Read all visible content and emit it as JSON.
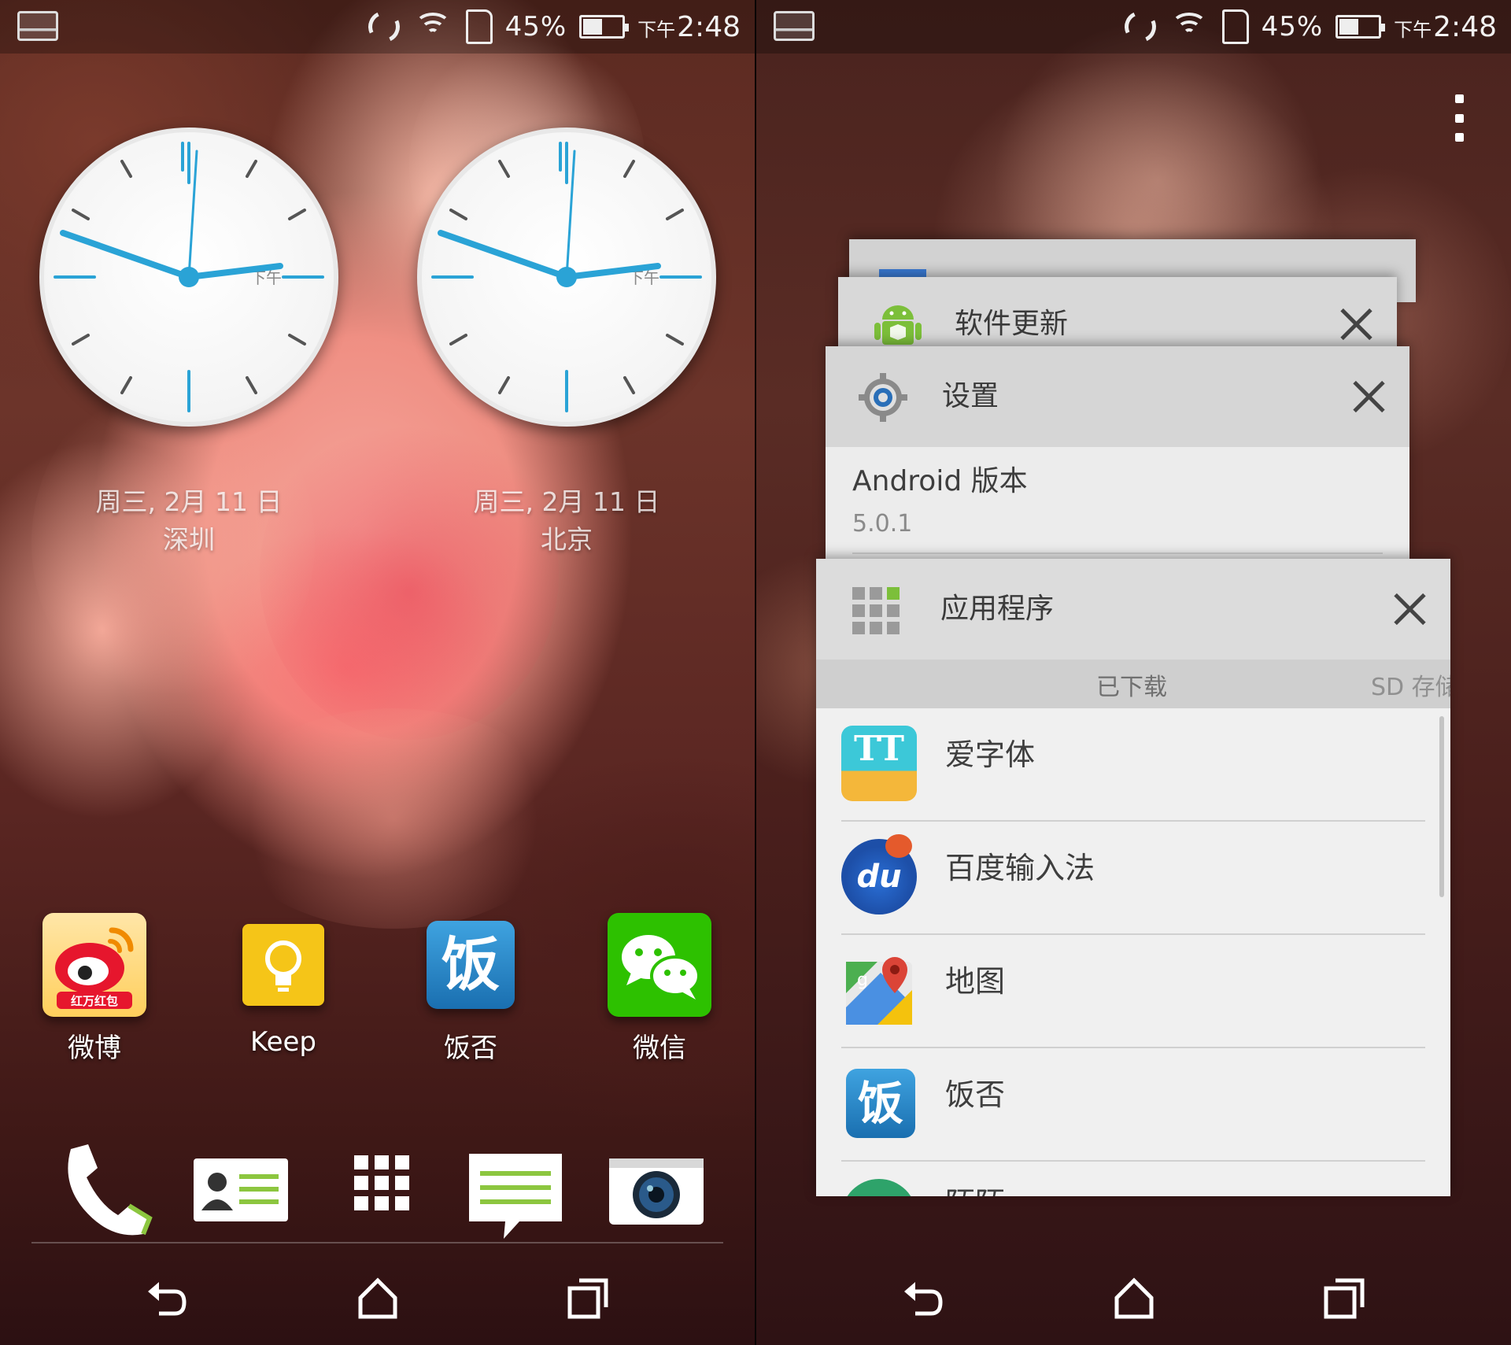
{
  "status_bar": {
    "battery_pct": "45%",
    "time_prefix": "下午",
    "time": "2:48"
  },
  "home": {
    "clocks": [
      {
        "date": "周三, 2月 11 日",
        "city": "深圳",
        "ampm": "下午"
      },
      {
        "date": "周三, 2月 11 日",
        "city": "北京",
        "ampm": "下午"
      }
    ],
    "apps": [
      {
        "label": "微博",
        "icon": "weibo-icon",
        "badge_text": "红万红包"
      },
      {
        "label": "Keep",
        "icon": "keep-lightbulb-icon"
      },
      {
        "label": "饭否",
        "icon": "fanfou-icon",
        "glyph": "饭"
      },
      {
        "label": "微信",
        "icon": "wechat-icon"
      }
    ],
    "dock": [
      "phone-icon",
      "contacts-icon",
      "app-drawer-icon",
      "messages-icon",
      "camera-icon"
    ]
  },
  "recents": {
    "cards": [
      {
        "title": "软件更新",
        "icon": "android-update-icon"
      },
      {
        "title": "设置",
        "icon": "settings-gear-icon",
        "setting_label": "Android 版本",
        "setting_value": "5.0.1"
      },
      {
        "title": "应用程序",
        "icon": "apps-grid-icon",
        "tabs": [
          "已下载",
          "SD 存储"
        ]
      }
    ],
    "app_list": [
      {
        "label": "爱字体",
        "icon": "aizi-font-icon"
      },
      {
        "label": "百度输入法",
        "icon": "baidu-ime-icon"
      },
      {
        "label": "地图",
        "icon": "google-maps-icon"
      },
      {
        "label": "饭否",
        "icon": "fanfou-icon",
        "glyph": "饭"
      },
      {
        "label": "陌陌",
        "icon": "partial-app-icon"
      }
    ]
  },
  "colors": {
    "clock_hand": "#2aa3d6",
    "weibo_red": "#e6162d",
    "keep_yellow": "#f5c518",
    "fanfou_blue": "#1f88c9",
    "wechat_green": "#2dc100"
  }
}
